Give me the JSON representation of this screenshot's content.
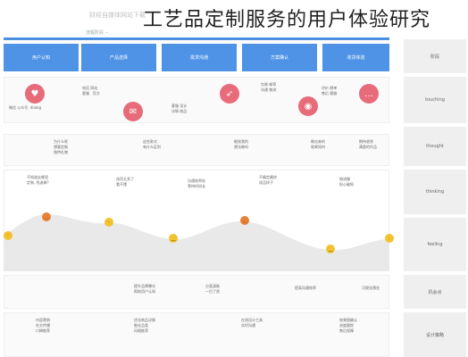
{
  "header": {
    "title": "工艺品定制服务的用户体验研究",
    "watermark": "财经自媒体网站下载",
    "stage_caption": "流程阶段 --"
  },
  "stages": [
    "用户认知",
    "产品选择",
    "需求沟通",
    "方案确认",
    "收货体验"
  ],
  "row_labels": [
    "阶段",
    "touching",
    "thought",
    "thinking",
    "feeling",
    "机会点",
    "设计策略"
  ],
  "touchpoints": [
    {
      "icon": "heart-icon",
      "glyph": "♥",
      "text": "微信 公众号  dialog"
    },
    {
      "icon": "mail-icon",
      "glyph": "✉",
      "text": "电话 网站\n客服   官方"
    },
    {
      "icon": "rocket-icon",
      "glyph": "➶",
      "text": "客服 设计\n详情 商品"
    },
    {
      "icon": "eye-icon",
      "glyph": "◉",
      "text": "包装 邮寄\n沟通 物流"
    },
    {
      "icon": "chat-icon",
      "glyph": "…",
      "text": "评价 晒单\n售后 客服"
    }
  ],
  "thoughts": [
    "为什么呢\n想要定制\n独特礼物",
    "这些款式\n有什么区别",
    "能按我的\n想法做吗",
    "做出来的\n效果如何",
    "期待收到\n满意的作品"
  ],
  "thinking": [
    "不知道去哪里\n定制, 找谁做?",
    "选项太多了\n看不懂",
    "沟通效率低\n等待时间长",
    "不确定最终\n成品样子",
    "物流慢\n担心破损"
  ],
  "opportunity": [
    "提升品牌曝光\n帮助用户认知",
    "分类清晰\n一目了然",
    "提高沟通效率",
    "可视化预览"
  ],
  "strategy": [
    "内容营销\n社交传播\n口碑推荐",
    "优化商品详情\n细化品类\n风格推荐",
    "在线设计工具\n实时沟通",
    "效果图确认\n进度跟踪\n售后保障"
  ],
  "colors": {
    "accent": "#4e93e6",
    "touch_icon": "#e86b7a",
    "emoji": "#f2c230",
    "curve_fill": "#e9e9e9"
  },
  "feelings": [
    "neutral",
    "happy",
    "neutral",
    "sad",
    "happy",
    "sad",
    "neutral"
  ]
}
